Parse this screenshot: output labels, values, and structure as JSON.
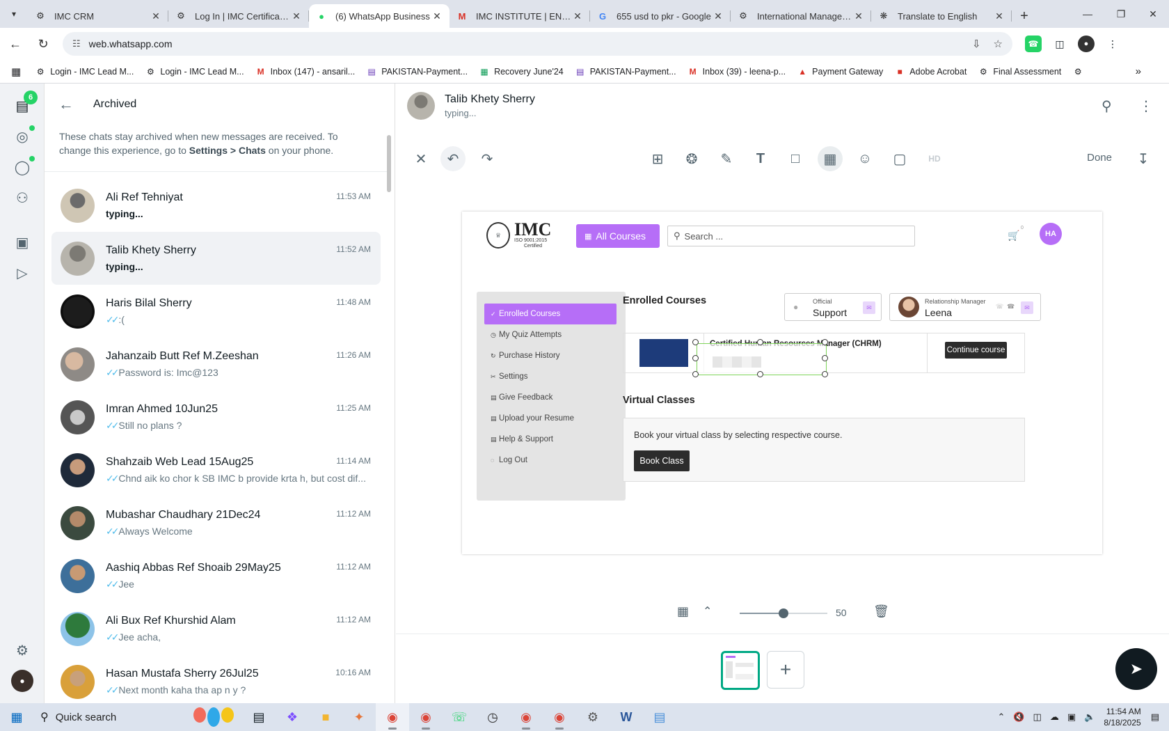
{
  "browser": {
    "tabs": [
      {
        "title": "IMC CRM",
        "active": false
      },
      {
        "title": "Log In | IMC Certification",
        "active": false
      },
      {
        "title": "(6) WhatsApp Business",
        "active": true
      },
      {
        "title": "IMC INSTITUTE | ENROLL",
        "active": false
      },
      {
        "title": "655 usd to pkr - Google",
        "active": false
      },
      {
        "title": "International Manageme",
        "active": false
      },
      {
        "title": "Translate to English",
        "active": false
      }
    ],
    "url": "web.whatsapp.com",
    "bookmarks": [
      "Login - IMC Lead M...",
      "Login - IMC Lead M...",
      "Inbox (147) - ansaril...",
      "PAKISTAN-Payment...",
      "Recovery June'24",
      "PAKISTAN-Payment...",
      "Inbox (39) - leena-p...",
      "Payment Gateway",
      "Adobe Acrobat",
      "Final Assessment"
    ]
  },
  "rail": {
    "unread_badge": "6"
  },
  "archived": {
    "title": "Archived",
    "note_pre": "These chats stay archived when new messages are received. To change this experience, go to ",
    "note_bold": "Settings > Chats",
    "note_post": " on your phone.",
    "chats": [
      {
        "name": "Ali Ref Tehniyat",
        "time": "11:53 AM",
        "msg": "typing...",
        "typing": true
      },
      {
        "name": "Talib Khety Sherry",
        "time": "11:52 AM",
        "msg": "typing...",
        "typing": true
      },
      {
        "name": "Haris Bilal Sherry",
        "time": "11:48 AM",
        "msg": ":(",
        "typing": false
      },
      {
        "name": "Jahanzaib Butt Ref M.Zeeshan",
        "time": "11:26 AM",
        "msg": "Password is: Imc@123",
        "typing": false
      },
      {
        "name": "Imran Ahmed 10Jun25",
        "time": "11:25 AM",
        "msg": "Still no plans ?",
        "typing": false
      },
      {
        "name": "Shahzaib Web Lead 15Aug25",
        "time": "11:14 AM",
        "msg": "Chnd aik ko chor k SB IMC b provide krta h, but cost dif...",
        "typing": false
      },
      {
        "name": "Mubashar Chaudhary 21Dec24",
        "time": "11:12 AM",
        "msg": "Always Welcome",
        "typing": false
      },
      {
        "name": "Aashiq Abbas Ref Shoaib 29May25",
        "time": "11:12 AM",
        "msg": "Jee",
        "typing": false
      },
      {
        "name": "Ali Bux Ref Khurshid Alam",
        "time": "11:12 AM",
        "msg": "Jee acha,",
        "typing": false
      },
      {
        "name": "Hasan Mustafa Sherry 26Jul25",
        "time": "10:16 AM",
        "msg": "Next month kaha tha ap n y ?",
        "typing": false
      }
    ]
  },
  "conversation": {
    "name": "Talib Khety Sherry",
    "status": "typing..."
  },
  "editor": {
    "done_label": "Done",
    "blur_value": "50",
    "blur_fraction": 0.5
  },
  "preview": {
    "logo_text": "IMC",
    "logo_sub1": "ISO 9001:2015",
    "logo_sub2": "Certified",
    "all_courses": "All Courses",
    "search_placeholder": "Search ...",
    "cart_count": "0",
    "user_initials": "HA",
    "nav": [
      "Enrolled Courses",
      "My Quiz Attempts",
      "Purchase History",
      "Settings",
      "Give Feedback",
      "Upload your Resume",
      "Help & Support",
      "Log Out"
    ],
    "enrolled_heading": "Enrolled Courses",
    "support_label": "Official",
    "support_value": "Support",
    "rm_label": "Relationship Manager",
    "rm_value": "Leena",
    "course_title": "Certified Human Resources Manager (CHRM)",
    "continue_label": "Continue course",
    "virtual_heading": "Virtual Classes",
    "virtual_text": "Book your virtual class by selecting respective course.",
    "book_label": "Book Class"
  },
  "taskbar": {
    "search_label": "Quick search",
    "time": "11:54 AM",
    "date": "8/18/2025"
  },
  "colors": {
    "whatsapp_green": "#25d366",
    "teal": "#00a884",
    "imc_purple": "#b66ef7"
  }
}
